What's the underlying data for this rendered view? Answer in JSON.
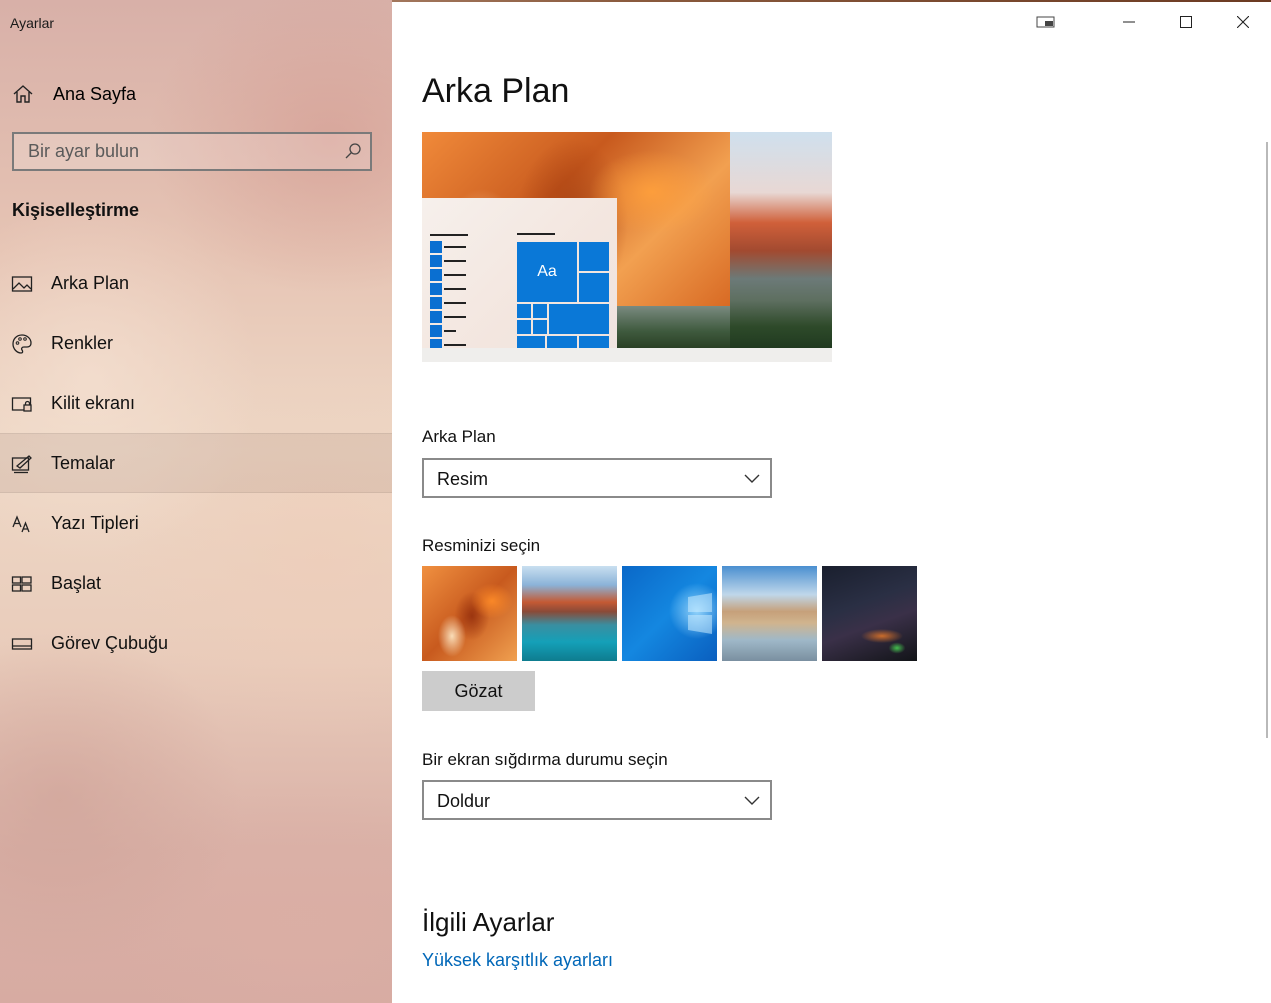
{
  "window": {
    "app_title": "Ayarlar"
  },
  "sidebar": {
    "home_label": "Ana Sayfa",
    "search_placeholder": "Bir ayar bulun",
    "section_title": "Kişiselleştirme",
    "items": [
      {
        "label": "Arka Plan",
        "icon": "picture-icon",
        "active": false
      },
      {
        "label": "Renkler",
        "icon": "palette-icon",
        "active": false
      },
      {
        "label": "Kilit ekranı",
        "icon": "lock-screen-icon",
        "active": false
      },
      {
        "label": "Temalar",
        "icon": "themes-icon",
        "active": true
      },
      {
        "label": "Yazı Tipleri",
        "icon": "fonts-icon",
        "active": false
      },
      {
        "label": "Başlat",
        "icon": "start-icon",
        "active": false
      },
      {
        "label": "Görev Çubuğu",
        "icon": "taskbar-icon",
        "active": false
      }
    ]
  },
  "main": {
    "title": "Arka Plan",
    "preview_tile_text": "Aa",
    "background_label": "Arka Plan",
    "background_value": "Resim",
    "choose_picture_label": "Resminizi seçin",
    "thumbnails": [
      "orange-abstract",
      "mountain-lake",
      "windows-blue",
      "beach-rocks",
      "night-sky-tent"
    ],
    "browse_label": "Gözat",
    "fit_label": "Bir ekran sığdırma durumu seçin",
    "fit_value": "Doldur",
    "related_title": "İlgili Ayarlar",
    "related_link": "Yüksek karşıtlık ayarları"
  },
  "colors": {
    "accent": "#0078d7",
    "link": "#0067b8"
  }
}
